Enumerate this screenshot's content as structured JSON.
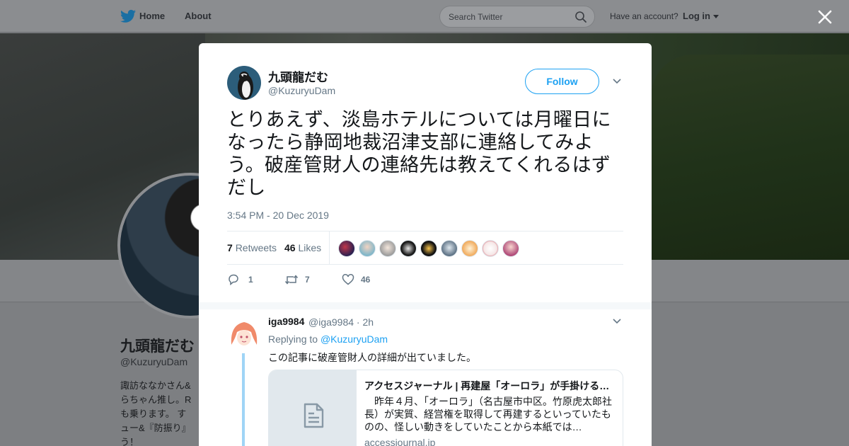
{
  "nav": {
    "home": "Home",
    "about": "About",
    "search_placeholder": "Search Twitter",
    "account_prompt": "Have an account?",
    "login": "Log in"
  },
  "profile": {
    "name": "九頭龍だむ",
    "handle": "@KuzuryuDam",
    "bio_partial": "諏訪ななかさん&\nらちゃん推し。R\nも乗ります。 す\nュー&『防振り』\nう！"
  },
  "tweet": {
    "author_name": "九頭龍だむ",
    "author_handle": "@KuzuryuDam",
    "follow_label": "Follow",
    "text": "とりあえず、淡島ホテルについては月曜日になったら静岡地裁沼津支部に連絡してみよう。破産管財人の連絡先は教えてくれるはずだし",
    "timestamp": "3:54 PM - 20 Dec 2019",
    "retweets_count": "7",
    "retweets_label": "Retweets",
    "likes_count": "46",
    "likes_label": "Likes",
    "reply_action_count": "1",
    "retweet_action_count": "7",
    "like_action_count": "46"
  },
  "reply": {
    "name": "iga9984",
    "handle_time": "@iga9984 · 2h",
    "replying_prefix": "Replying to",
    "replying_to": "@KuzuryuDam",
    "text": "この記事に破産管財人の詳細が出ていました。",
    "card": {
      "title": "アクセスジャーナル | 再建屋「オーロラ」が手掛ける…",
      "description": "　昨年４月、「オーロラ」（名古屋市中区。竹原虎太郎社長）が実質、経営権を取得して再建するといっていたものの、怪しい動きをしていたことから本紙では…",
      "domain": "accessjournal.jp"
    }
  },
  "colors": {
    "accent": "#1da1f2",
    "secondary_text": "#657786",
    "thread_line": "#9fd4f6"
  },
  "icons": [
    "twitter-bird-icon",
    "search-icon",
    "caret-down-icon",
    "close-icon",
    "chevron-down-icon",
    "reply-icon",
    "retweet-icon",
    "heart-icon",
    "document-icon"
  ]
}
